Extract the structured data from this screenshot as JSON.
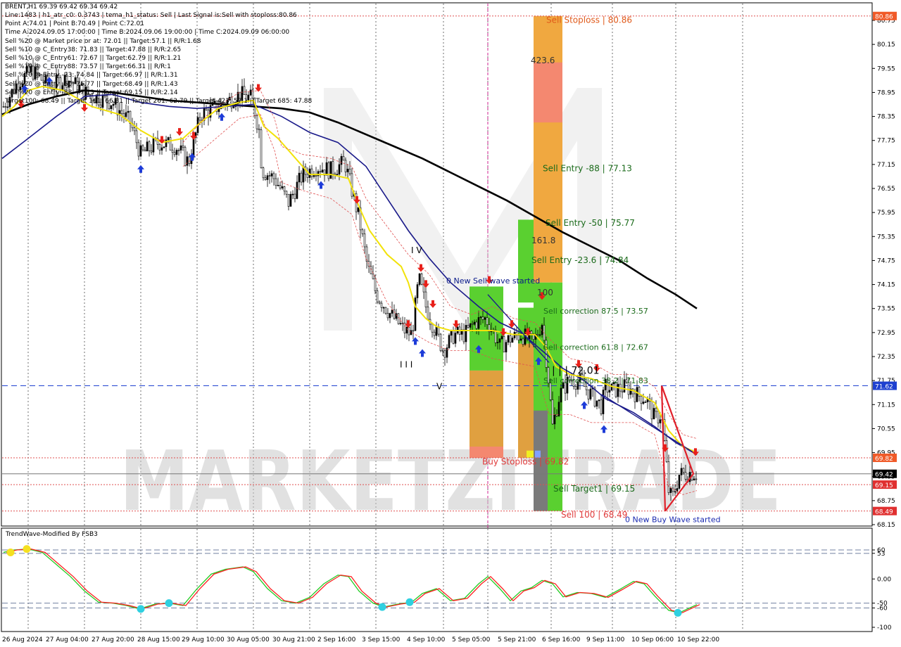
{
  "header": {
    "symbol_line": "BRENT,H1  69.39 69.42 69.34 69.42",
    "info_lines": [
      "Line:1483  | h1_atr_c0: 0.3743  | tema_h1_status: Sell  | Last Signal is:Sell with stoploss:80.86",
      "Point A:74.01  | Point B:70.49  | Point C:72.01",
      "Time A:2024.09.05 17:00:00  | Time B:2024.09.06 19:00:00  | Time C:2024.09.09 06:00:00",
      "Sell %20 @ Market price or at: 72.01  || Target:57.1  || R/R:1.68",
      "Sell %10 @ C_Entry38: 71.83  || Target:47.88  || R/R:2.65",
      "Sell %10 @ C_Entry61: 72.67  || Target:62.79  || R/R:1.21",
      "Sell %10 @ C_Entry88: 73.57  || Target:66.31  || R/R:1",
      "Sell %10 @ Entry -23: 74.84  || Target:66.97  || R/R:1.31",
      "Sell %20 @ Entry -50: 75.77  || Target:68.49  || R/R:1.43",
      "Sell %20 @ Entry -88: 77.13  || Target:69.15  || R/R:2.14",
      "Target100: 68.49  || Target 161: 66.31  || Target 261: 62.79  || Target 423: 57.1  || Target 685: 47.88"
    ]
  },
  "chart_data": [
    {
      "type": "line",
      "title": "BRENT,H1",
      "ylim": [
        68.15,
        80.75
      ],
      "y_ticks": [
        "80.75",
        "80.15",
        "79.55",
        "78.95",
        "78.35",
        "77.75",
        "77.15",
        "76.55",
        "75.95",
        "75.35",
        "74.75",
        "74.15",
        "73.55",
        "72.95",
        "72.35",
        "71.75",
        "71.15",
        "70.55",
        "69.95",
        "69.35",
        "68.75",
        "68.15"
      ],
      "x_ticks": [
        "26 Aug 2024",
        "27 Aug 04:00",
        "27 Aug 20:00",
        "28 Aug 15:00",
        "29 Aug 10:00",
        "30 Aug 05:00",
        "30 Aug 21:00",
        "2 Sep 16:00",
        "3 Sep 15:00",
        "4 Sep 10:00",
        "5 Sep 05:00",
        "5 Sep 21:00",
        "6 Sep 16:00",
        "9 Sep 11:00",
        "10 Sep 06:00",
        "10 Sep 22:00"
      ],
      "price_labels": [
        {
          "value": 80.86,
          "text": "80.86",
          "color": "#f05a28"
        },
        {
          "value": 71.62,
          "text": "71.62",
          "color": "#1e40d0"
        },
        {
          "value": 69.82,
          "text": "69.82",
          "color": "#f05a28"
        },
        {
          "value": 69.42,
          "text": "69.42",
          "color": "#000000"
        },
        {
          "value": 69.15,
          "text": "69.15",
          "color": "#e03030"
        },
        {
          "value": 68.49,
          "text": "68.49",
          "color": "#e03030"
        }
      ],
      "levels": [
        {
          "value": 80.86,
          "style": "dotted",
          "color": "#e05050"
        },
        {
          "value": 71.62,
          "style": "dashed",
          "color": "#1e40d0"
        },
        {
          "value": 69.82,
          "style": "dotted",
          "color": "#e05050"
        },
        {
          "value": 69.42,
          "style": "solid",
          "color": "#777777"
        },
        {
          "value": 69.15,
          "style": "dotted",
          "color": "#e05050"
        },
        {
          "value": 68.49,
          "style": "dotted",
          "color": "#e05050"
        }
      ],
      "annotations": [
        {
          "text": "Sell Stoploss | 80.86",
          "color": "#e05a1a"
        },
        {
          "text": "423.6",
          "color": "#333333"
        },
        {
          "text": "Sell Entry -88 | 77.13",
          "color": "#1a6a1a"
        },
        {
          "text": "Sell Entry -50 | 75.77",
          "color": "#1a6a1a"
        },
        {
          "text": "161.8",
          "color": "#333333"
        },
        {
          "text": "Sell Entry -23.6 | 74.84",
          "color": "#1a6a1a"
        },
        {
          "text": "100",
          "color": "#333333"
        },
        {
          "text": "Sell correction 87.5 | 73.57",
          "color": "#1a6a1a"
        },
        {
          "text": "Sell correction 61.8 | 72.67",
          "color": "#1a6a1a"
        },
        {
          "text": "Sell correction 38.2 | 71.83",
          "color": "#1a6a1a"
        },
        {
          "text": "I I I",
          "color": "#000000"
        },
        {
          "text": "V",
          "color": "#000000"
        },
        {
          "text": "I V",
          "color": "#000000"
        },
        {
          "text": "0 New Sell wave started",
          "color": "#0a1a8a"
        },
        {
          "text": "0 New Buy Wave started",
          "color": "#1a2ab0"
        },
        {
          "text": "Buy Stoploss | 69.82",
          "color": "#e03a3a"
        },
        {
          "text": "Sell Target1 | 69.15",
          "color": "#1a6a1a"
        },
        {
          "text": "Sell 100 | 68.49",
          "color": "#e03a3a"
        }
      ],
      "point_c_label": "| | | 72.01",
      "series": [
        {
          "name": "price",
          "color": "#000000"
        },
        {
          "name": "ma_yellow",
          "color": "#f2e20a"
        },
        {
          "name": "ma_blue",
          "color": "#1a1a8a"
        },
        {
          "name": "ma_black",
          "color": "#000000"
        }
      ]
    },
    {
      "type": "line",
      "title": "TrendWave-Modified By FSB3",
      "ylim": [
        -100,
        100
      ],
      "y_ticks": [
        "60",
        "53",
        "0.00",
        "-50",
        "-60",
        "-100"
      ],
      "series": [
        {
          "name": "fast",
          "color": "#22cc22"
        },
        {
          "name": "slow",
          "color": "#ff2020"
        }
      ],
      "levels": [
        60,
        53,
        -50,
        -60
      ]
    }
  ],
  "watermark": "MARKETZITRADE"
}
